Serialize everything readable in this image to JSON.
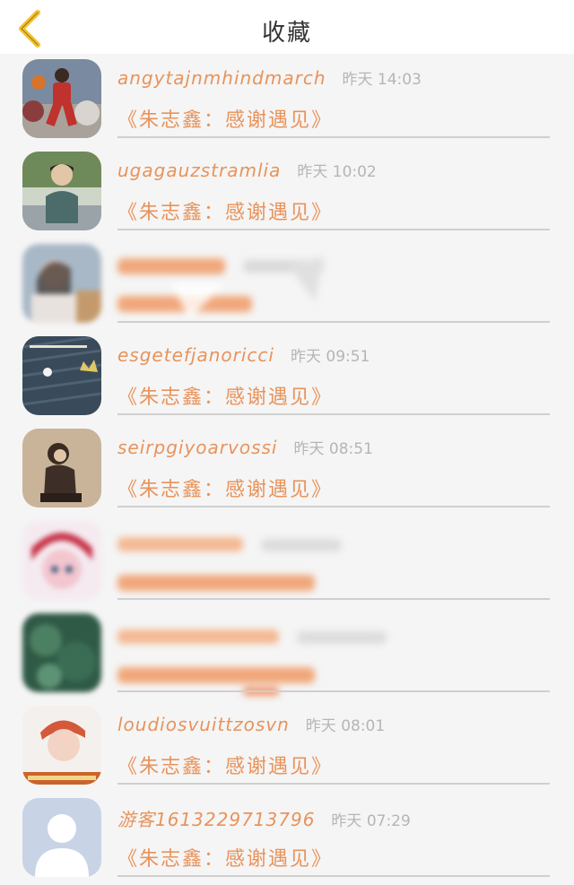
{
  "header": {
    "title": "收藏",
    "back_icon": "chevron-left-icon",
    "accent_color": "#f2c230"
  },
  "items": [
    {
      "username": "angytajnmhindmarch",
      "time": "昨天 14:03",
      "title": "《朱志鑫：感谢遇见》",
      "avatar": "basketball-player-avatar",
      "blurred": false
    },
    {
      "username": "ugagauzstramlia",
      "time": "昨天 10:02",
      "title": "《朱志鑫：感谢遇见》",
      "avatar": "boy-photo-avatar",
      "blurred": false
    },
    {
      "username": "",
      "time": "",
      "title": "",
      "avatar": "girl-photo-avatar",
      "blurred": true
    },
    {
      "username": "esgetefjanoricci",
      "time": "昨天 09:51",
      "title": "《朱志鑫：感谢遇见》",
      "avatar": "sweater-crown-avatar",
      "blurred": false
    },
    {
      "username": "seirpgiyoarvossi",
      "time": "昨天 08:51",
      "title": "《朱志鑫：感谢遇见》",
      "avatar": "girl-sand-avatar",
      "blurred": false
    },
    {
      "username": "",
      "time": "",
      "title": "",
      "avatar": "anime-girl-avatar",
      "blurred": true
    },
    {
      "username": "",
      "time": "",
      "title": "",
      "avatar": "leaves-avatar",
      "blurred": true
    },
    {
      "username": "loudiosvuittzosvn",
      "time": "昨天 08:01",
      "title": "《朱志鑫：感谢遇见》",
      "avatar": "boy-red-hair-avatar",
      "blurred": false
    },
    {
      "username": "游客1613229713796",
      "time": "昨天 07:29",
      "title": "《朱志鑫：感谢遇见》",
      "avatar": "default-user-avatar",
      "blurred": false
    }
  ]
}
